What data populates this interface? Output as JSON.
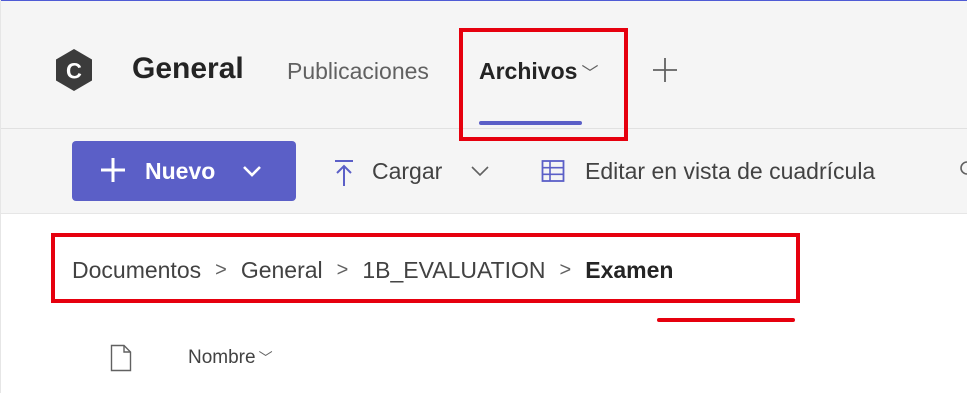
{
  "header": {
    "team_initial": "C",
    "channel_title": "General",
    "tabs": [
      {
        "label": "Publicaciones",
        "active": false
      },
      {
        "label": "Archivos",
        "active": true,
        "dropdown": true
      }
    ],
    "add_tab_icon": "plus-icon"
  },
  "toolbar": {
    "new_label": "Nuevo",
    "upload_label": "Cargar",
    "grid_edit_label": "Editar en vista de cuadrícula"
  },
  "breadcrumb": {
    "items": [
      "Documentos",
      "General",
      "1B_EVALUATION",
      "Examen"
    ],
    "separator": ">"
  },
  "file_list": {
    "columns": [
      {
        "label": "Nombre",
        "sortable": true
      }
    ]
  },
  "colors": {
    "accent": "#5b5fc7",
    "avatar": "#3b3b3b",
    "annotation_red": "#e6000e",
    "header_bg": "#f5f5f5"
  }
}
